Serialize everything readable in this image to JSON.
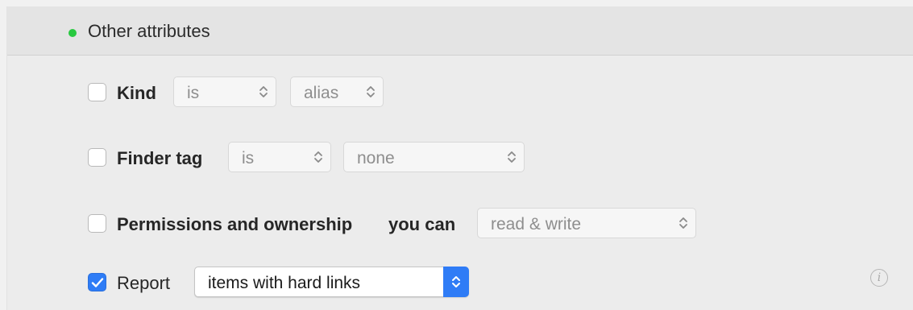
{
  "section": {
    "title": "Other attributes",
    "status_color": "#28c940"
  },
  "criteria": [
    {
      "label": "Kind",
      "checked": false,
      "operator": "is",
      "value": "alias"
    },
    {
      "label": "Finder tag",
      "checked": false,
      "operator": "is",
      "value": "none"
    },
    {
      "label": "Permissions and ownership",
      "checked": false,
      "connector": "you can",
      "value": "read & write"
    },
    {
      "label": "Report",
      "checked": true,
      "value": "items with hard links"
    }
  ],
  "icons": {
    "status": "green-status-dot",
    "checkbox_checked": "checkmark-icon",
    "popup": "chevron-up-down-icon",
    "info": "info-icon"
  },
  "info_glyph": "i",
  "colors": {
    "accent": "#2f7cf6",
    "status_green": "#28c940"
  }
}
